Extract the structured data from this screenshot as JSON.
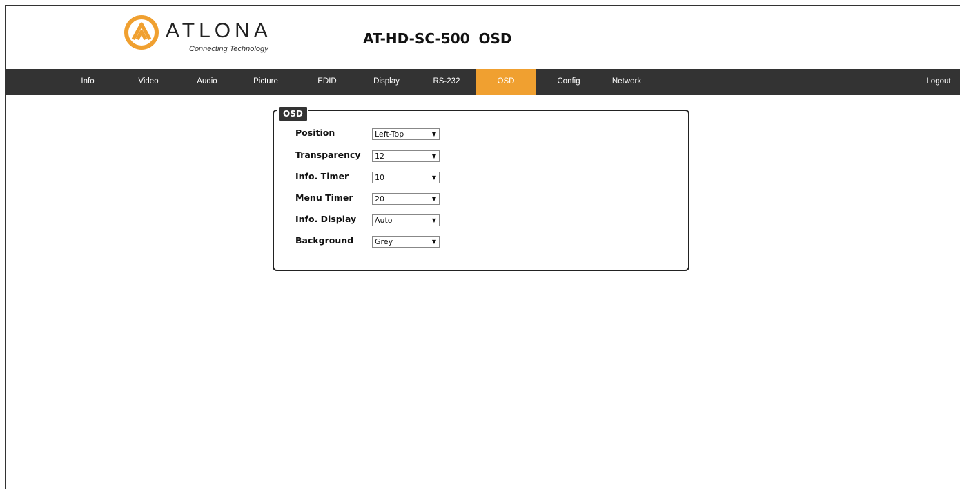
{
  "brand": {
    "name": "ATLONA",
    "tagline": "Connecting Technology",
    "colors": {
      "orange": "#f0a030",
      "dark": "#333333"
    }
  },
  "page_title": "AT-HD-SC-500  OSD",
  "nav": {
    "items": [
      {
        "label": "Info"
      },
      {
        "label": "Video"
      },
      {
        "label": "Audio"
      },
      {
        "label": "Picture"
      },
      {
        "label": "EDID"
      },
      {
        "label": "Display"
      },
      {
        "label": "RS-232"
      },
      {
        "label": "OSD"
      },
      {
        "label": "Config"
      },
      {
        "label": "Network"
      }
    ],
    "active": "OSD",
    "logout": "Logout"
  },
  "osd": {
    "legend": "OSD",
    "fields": [
      {
        "label": "Position",
        "value": "Left-Top"
      },
      {
        "label": "Transparency",
        "value": "12"
      },
      {
        "label": "Info. Timer",
        "value": "10"
      },
      {
        "label": "Menu Timer",
        "value": "20"
      },
      {
        "label": "Info. Display",
        "value": "Auto"
      },
      {
        "label": "Background",
        "value": "Grey"
      }
    ]
  }
}
